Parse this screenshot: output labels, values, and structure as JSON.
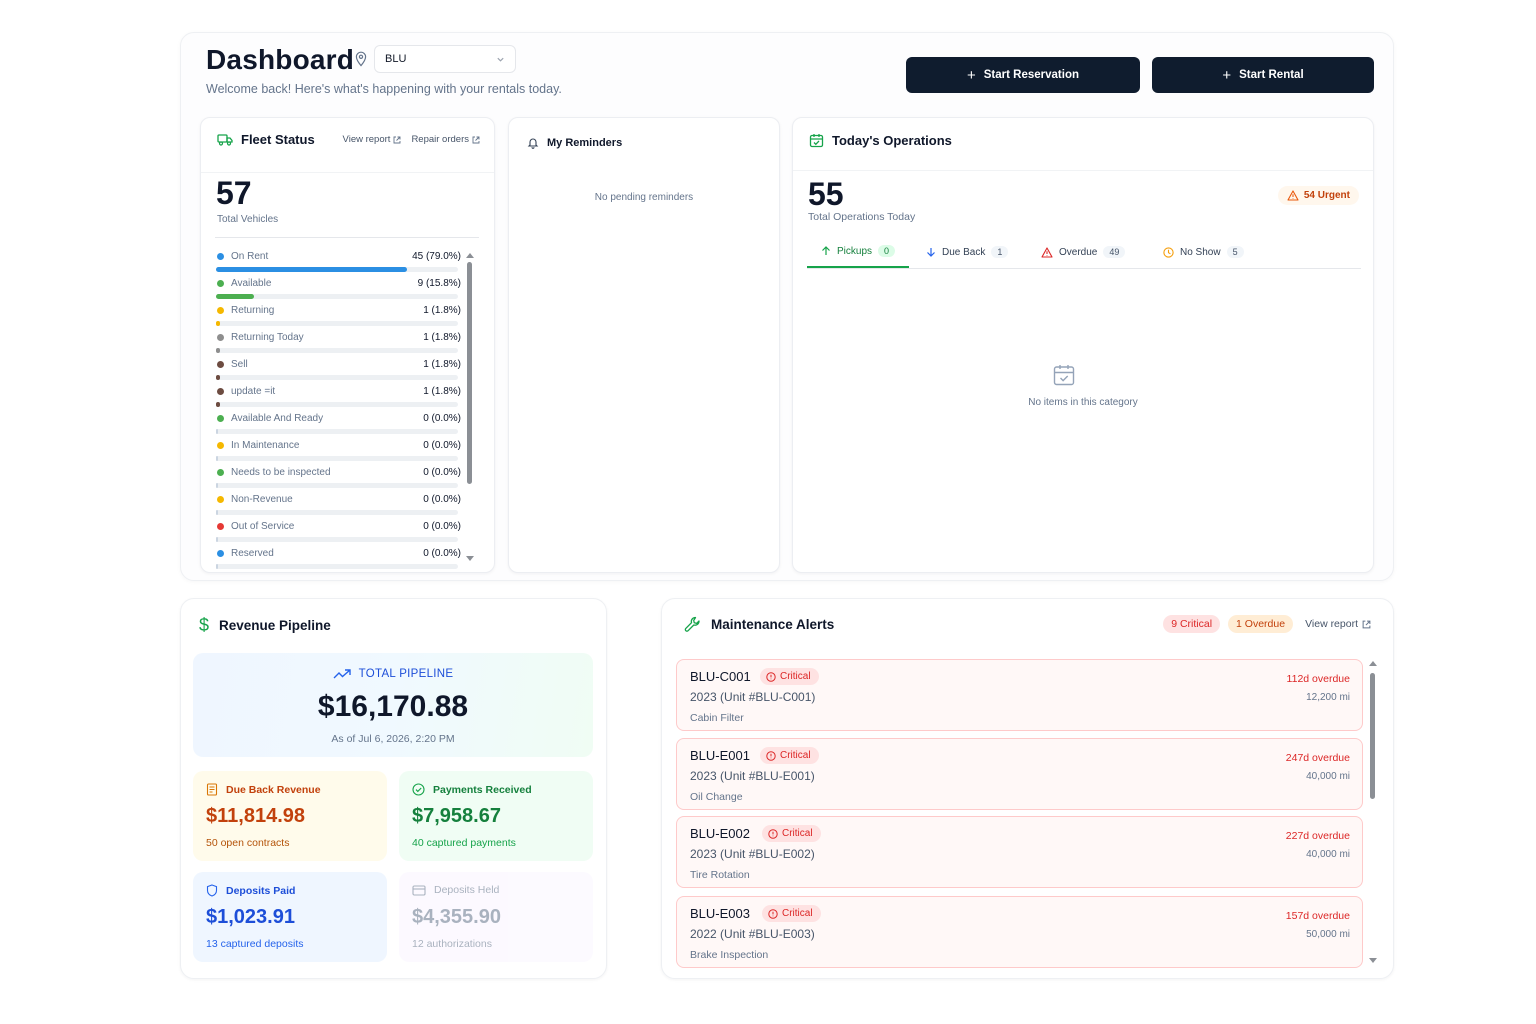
{
  "header": {
    "title": "Dashboard",
    "location": "BLU",
    "welcome": "Welcome back! Here's what's happening with your rentals today.",
    "start_reservation": "Start Reservation",
    "start_rental": "Start Rental"
  },
  "fleet": {
    "title": "Fleet Status",
    "view_report": "View report",
    "repair_orders": "Repair orders",
    "total": "57",
    "total_label": "Total Vehicles",
    "items": [
      {
        "name": "On Rent",
        "value": "45 (79.0%)",
        "pct": 79.0,
        "color": "#2b8fe3"
      },
      {
        "name": "Available",
        "value": "9 (15.8%)",
        "pct": 15.8,
        "color": "#4caf50"
      },
      {
        "name": "Returning",
        "value": "1 (1.8%)",
        "pct": 1.8,
        "color": "#f5b800"
      },
      {
        "name": "Returning Today",
        "value": "1 (1.8%)",
        "pct": 1.8,
        "color": "#8e8e8e"
      },
      {
        "name": "Sell",
        "value": "1 (1.8%)",
        "pct": 1.8,
        "color": "#6d4c41"
      },
      {
        "name": "update =it",
        "value": "1 (1.8%)",
        "pct": 1.8,
        "color": "#6d4c41"
      },
      {
        "name": "Available And Ready",
        "value": "0 (0.0%)",
        "pct": 0,
        "color": "#4caf50"
      },
      {
        "name": "In Maintenance",
        "value": "0 (0.0%)",
        "pct": 0,
        "color": "#f5b800"
      },
      {
        "name": "Needs to be inspected",
        "value": "0 (0.0%)",
        "pct": 0,
        "color": "#4caf50"
      },
      {
        "name": "Non-Revenue",
        "value": "0 (0.0%)",
        "pct": 0,
        "color": "#f5b800"
      },
      {
        "name": "Out of Service",
        "value": "0 (0.0%)",
        "pct": 0,
        "color": "#e53935"
      },
      {
        "name": "Reserved",
        "value": "0 (0.0%)",
        "pct": 0,
        "color": "#2b8fe3"
      }
    ]
  },
  "reminders": {
    "title": "My Reminders",
    "empty": "No pending reminders"
  },
  "operations": {
    "title": "Today's Operations",
    "total": "55",
    "total_label": "Total Operations Today",
    "urgent": "54 Urgent",
    "tabs": [
      {
        "label": "Pickups",
        "count": "0"
      },
      {
        "label": "Due Back",
        "count": "1"
      },
      {
        "label": "Overdue",
        "count": "49"
      },
      {
        "label": "No Show",
        "count": "5"
      }
    ],
    "empty": "No items in this category"
  },
  "revenue": {
    "title": "Revenue Pipeline",
    "pipeline_label": "TOTAL PIPELINE",
    "pipeline_amount": "$16,170.88",
    "as_of": "As of Jul 6, 2026, 2:20 PM",
    "due_back": {
      "label": "Due Back Revenue",
      "amount": "$11,814.98",
      "sub": "50 open contracts"
    },
    "payments": {
      "label": "Payments Received",
      "amount": "$7,958.67",
      "sub": "40 captured payments"
    },
    "deposits_paid": {
      "label": "Deposits Paid",
      "amount": "$1,023.91",
      "sub": "13 captured deposits"
    },
    "deposits_held": {
      "label": "Deposits Held",
      "amount": "$4,355.90",
      "sub": "12 authorizations"
    }
  },
  "maintenance": {
    "title": "Maintenance Alerts",
    "critical_badge": "9 Critical",
    "overdue_badge": "1 Overdue",
    "view_report": "View report",
    "alerts": [
      {
        "unit": "BLU-C001",
        "level": "Critical",
        "desc": "2023 (Unit #BLU-C001)",
        "service": "Cabin Filter",
        "overdue": "112d overdue",
        "miles": "12,200 mi"
      },
      {
        "unit": "BLU-E001",
        "level": "Critical",
        "desc": "2023 (Unit #BLU-E001)",
        "service": "Oil Change",
        "overdue": "247d overdue",
        "miles": "40,000 mi"
      },
      {
        "unit": "BLU-E002",
        "level": "Critical",
        "desc": "2023 (Unit #BLU-E002)",
        "service": "Tire Rotation",
        "overdue": "227d overdue",
        "miles": "40,000 mi"
      },
      {
        "unit": "BLU-E003",
        "level": "Critical",
        "desc": "2022 (Unit #BLU-E003)",
        "service": "Brake Inspection",
        "overdue": "157d overdue",
        "miles": "50,000 mi"
      }
    ]
  }
}
